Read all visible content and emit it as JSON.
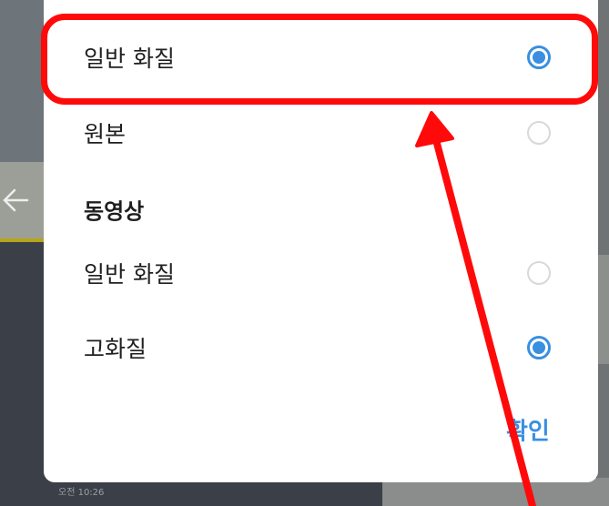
{
  "dialog": {
    "photo_options": [
      {
        "label": "일반 화질",
        "selected": true
      },
      {
        "label": "원본",
        "selected": false
      }
    ],
    "video_section_title": "동영상",
    "video_options": [
      {
        "label": "일반 화질",
        "selected": false
      },
      {
        "label": "고화질",
        "selected": true
      }
    ],
    "confirm_label": "확인"
  },
  "background": {
    "timestamp": "오전 10:26"
  },
  "colors": {
    "accent": "#3a8fe0",
    "annotation": "#ff0a0a",
    "dialog_bg": "#ffffff"
  }
}
